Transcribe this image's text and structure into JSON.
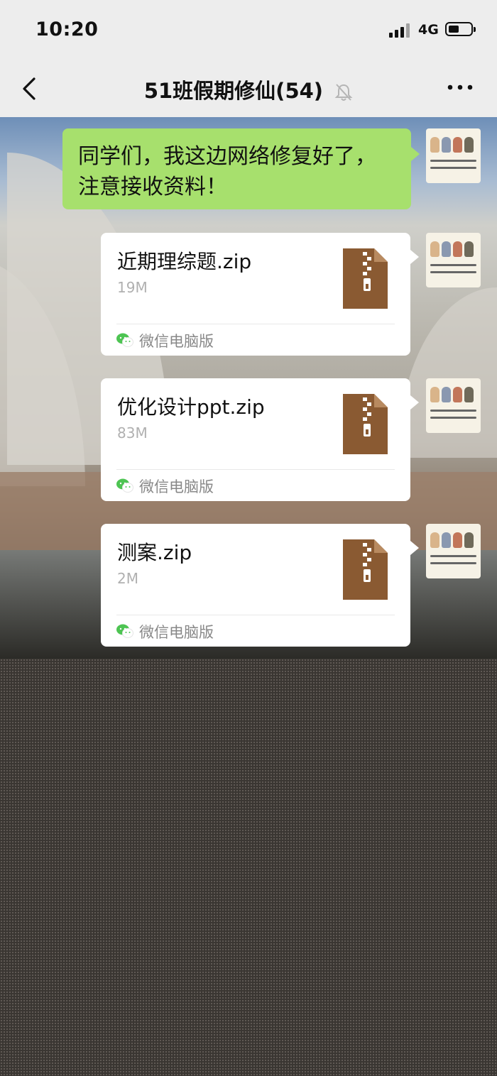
{
  "status_bar": {
    "time": "10:20",
    "network": "4G"
  },
  "header": {
    "title": "51班假期修仙(54)"
  },
  "messages": [
    {
      "type": "text",
      "lines": [
        "同学们，我这边网络修复好了，",
        "注意接收资料！"
      ]
    },
    {
      "type": "file",
      "name": "近期理综题.zip",
      "size": "19M",
      "source": "微信电脑版"
    },
    {
      "type": "file",
      "name": "优化设计ppt.zip",
      "size": "83M",
      "source": "微信电脑版"
    },
    {
      "type": "file",
      "name": "测案.zip",
      "size": "2M",
      "source": "微信电脑版"
    }
  ],
  "colors": {
    "bubble_green": "#a7e06d",
    "zip_brown": "#8a5a32",
    "bar_bg": "#ededed"
  }
}
